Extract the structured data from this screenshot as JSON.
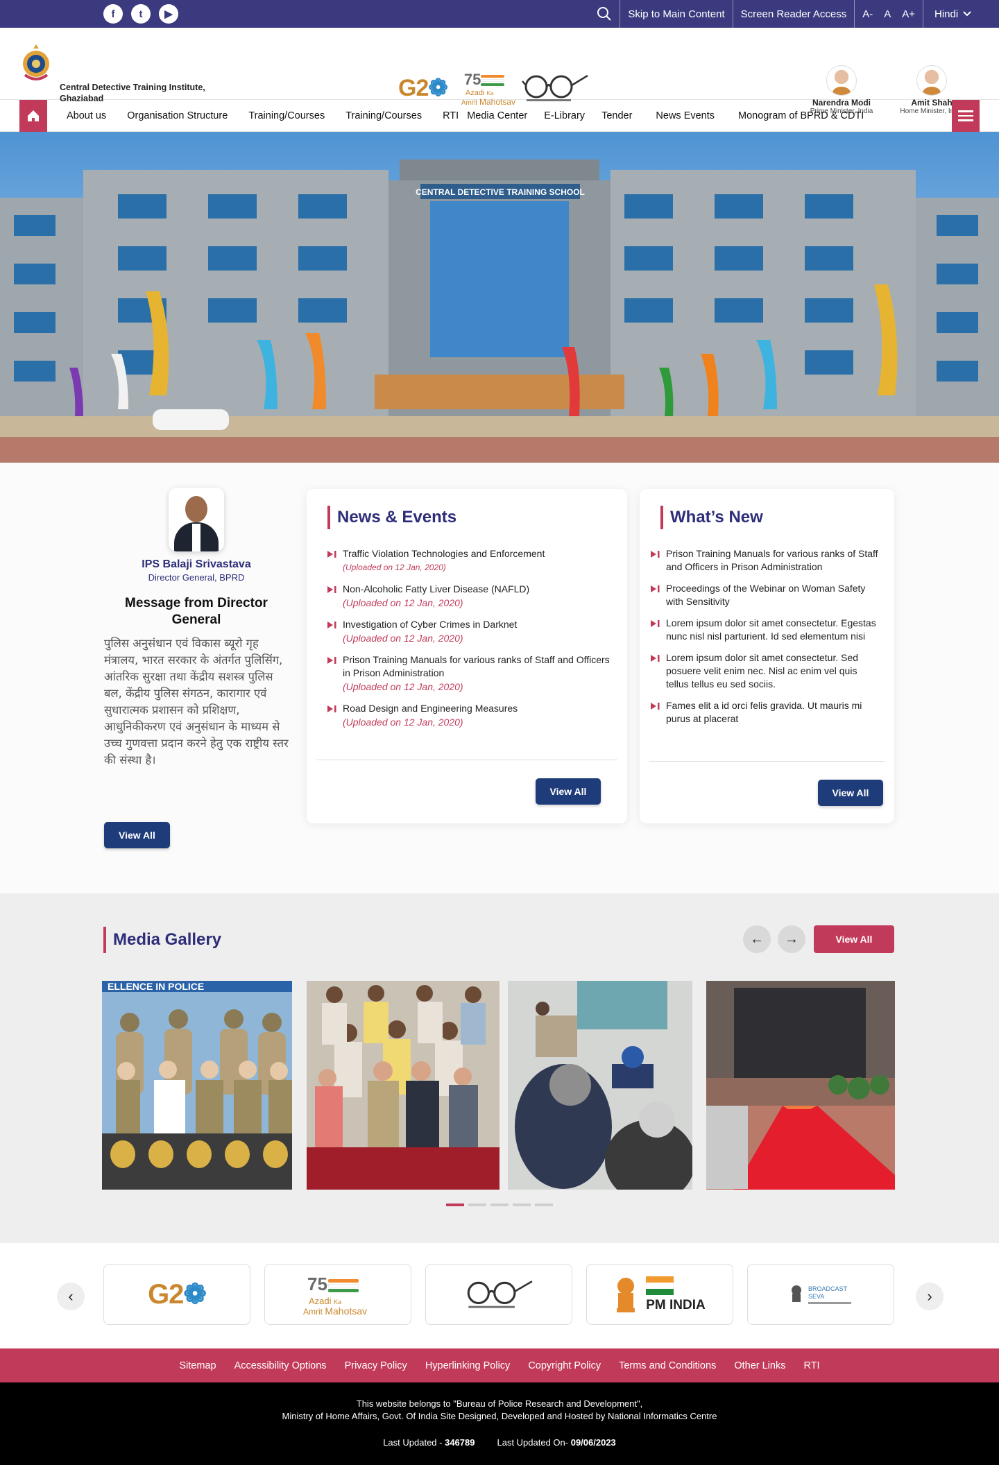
{
  "topbar": {
    "social": [
      "facebook-icon",
      "twitter-icon",
      "youtube-icon"
    ],
    "skip": "Skip to Main Content",
    "screen_reader": "Screen Reader Access",
    "font_sizes": [
      "A-",
      "A",
      "A+"
    ],
    "language": "Hindi"
  },
  "header": {
    "org_line1": "Central Detective Training Institute,",
    "org_line2": "Ghaziabad",
    "g20_text": "G2",
    "azadi_num": "75",
    "azadi_1": "Azadi",
    "azadi_2": "Ka",
    "azadi_3": "Amrit",
    "azadi_4": "Mahotsav",
    "leaders": [
      {
        "name": "Narendra Modi",
        "role": "Prime Minister, India"
      },
      {
        "name": "Amit Shah",
        "role": "Home Minister, India"
      }
    ]
  },
  "nav": {
    "items": [
      "About us",
      "Organisation Structure",
      "Training/Courses",
      "Training/Courses",
      "RTI",
      "Media Center",
      "E-Library",
      "Tender",
      "News Events",
      "Monogram of BPRD & CDTI"
    ]
  },
  "hero": {
    "sign": "CENTRAL DETECTIVE TRAINING SCHOOL"
  },
  "director": {
    "name": "IPS Balaji Srivastava",
    "role": "Director General, BPRD",
    "title": "Message from Director General",
    "message": "पुलिस अनुसंधान एवं विकास ब्यूरो गृह मंत्रालय, भारत सरकार के अंतर्गत पुलिसिंग, आंतरिक सुरक्षा तथा केंद्रीय सशस्त्र पुलिस बल, केंद्रीय पुलिस संगठन, कारागार एवं सुधारात्मक प्रशासन को प्रशिक्षण, आधुनिकीकरण एवं अनुसंधान के माध्यम से उच्च गुणवत्ता प्रदान करने हेतु एक राष्ट्रीय स्तर की संस्था है।",
    "view_all": "View All"
  },
  "news": {
    "title": "News & Events",
    "items": [
      {
        "text": "Traffic Violation Technologies and Enforcement",
        "date": "(Uploaded on 12 Jan, 2020)"
      },
      {
        "text": "Non-Alcoholic Fatty Liver Disease (NAFLD)",
        "date": "(Uploaded on 12 Jan, 2020)"
      },
      {
        "text": "Investigation of Cyber Crimes in Darknet",
        "date": "(Uploaded on 12 Jan, 2020)"
      },
      {
        "text": "Prison Training Manuals for various ranks of Staff and Officers in Prison Administration",
        "date": "(Uploaded on 12 Jan, 2020)"
      },
      {
        "text": "Road Design and Engineering Measures",
        "date": "(Uploaded on 12 Jan, 2020)"
      }
    ],
    "view_all": "View All"
  },
  "whats_new": {
    "title": "What’s New",
    "items": [
      "Prison Training Manuals for various ranks of Staff and Officers in Prison Administration",
      "Proceedings of the Webinar on Woman Safety with Sensitivity",
      "Lorem ipsum dolor sit amet consectetur. Egestas nunc nisl nisl parturient. Id sed elementum nisi",
      "Lorem ipsum dolor sit amet consectetur. Sed posuere velit enim nec. Nisl ac enim vel quis tellus tellus eu sed sociis.",
      "Fames elit a id orci felis gravida. Ut mauris mi purus at placerat"
    ],
    "view_all": "View All"
  },
  "gallery": {
    "title": "Media Gallery",
    "view_all": "View All",
    "prev": "←",
    "next": "→",
    "banner_text": "ELLENCE IN POLICE"
  },
  "partners": {
    "prev": "‹",
    "next": "›",
    "pmindia": "PM INDIA",
    "broadcast_1": "BROADCAST",
    "broadcast_2": "SEVA"
  },
  "footer_links": [
    "Sitemap",
    "Accessibility Options",
    "Privacy Policy",
    "Hyperlinking Policy",
    "Copyright Policy",
    "Terms and Conditions",
    "Other Links",
    "RTI"
  ],
  "footer": {
    "line1": "This website belongs to \"Bureau of Police Research and Development\",",
    "line2": "Ministry of Home Affairs, Govt. Of India Site Designed, Developed and Hosted by National Informatics Centre",
    "last_updated_label": "Last Updated - ",
    "last_updated_value": "346789",
    "last_updated_on_label": "Last Updated On- ",
    "last_updated_on_value": "09/06/2023"
  },
  "colors": {
    "primary": "#3b3a7e",
    "accent": "#c23a5a",
    "button": "#1f3c7a"
  }
}
